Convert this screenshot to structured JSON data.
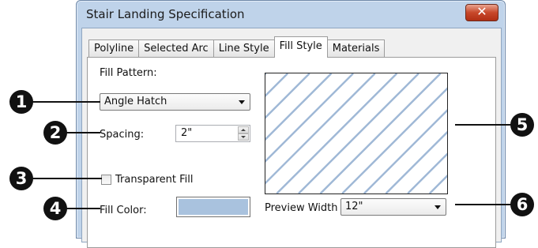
{
  "dialog": {
    "title": "Stair Landing Specification",
    "close_glyph": "✕"
  },
  "tabs": [
    {
      "label": "Polyline",
      "active": false
    },
    {
      "label": "Selected Arc",
      "active": false
    },
    {
      "label": "Line Style",
      "active": false
    },
    {
      "label": "Fill Style",
      "active": true
    },
    {
      "label": "Materials",
      "active": false
    }
  ],
  "fill_style": {
    "fill_pattern_label": "Fill Pattern:",
    "fill_pattern_value": "Angle Hatch",
    "spacing_label": "Spacing:",
    "spacing_value": "2\"",
    "transparent_fill_label": "Transparent Fill",
    "transparent_fill_checked": false,
    "fill_color_label": "Fill Color:",
    "fill_color": "#a9c2de",
    "hatch_color": "#9fb8d6",
    "preview_width_label": "Preview Width",
    "preview_width_value": "12\""
  },
  "callouts": [
    "1",
    "2",
    "3",
    "4",
    "5",
    "6"
  ]
}
